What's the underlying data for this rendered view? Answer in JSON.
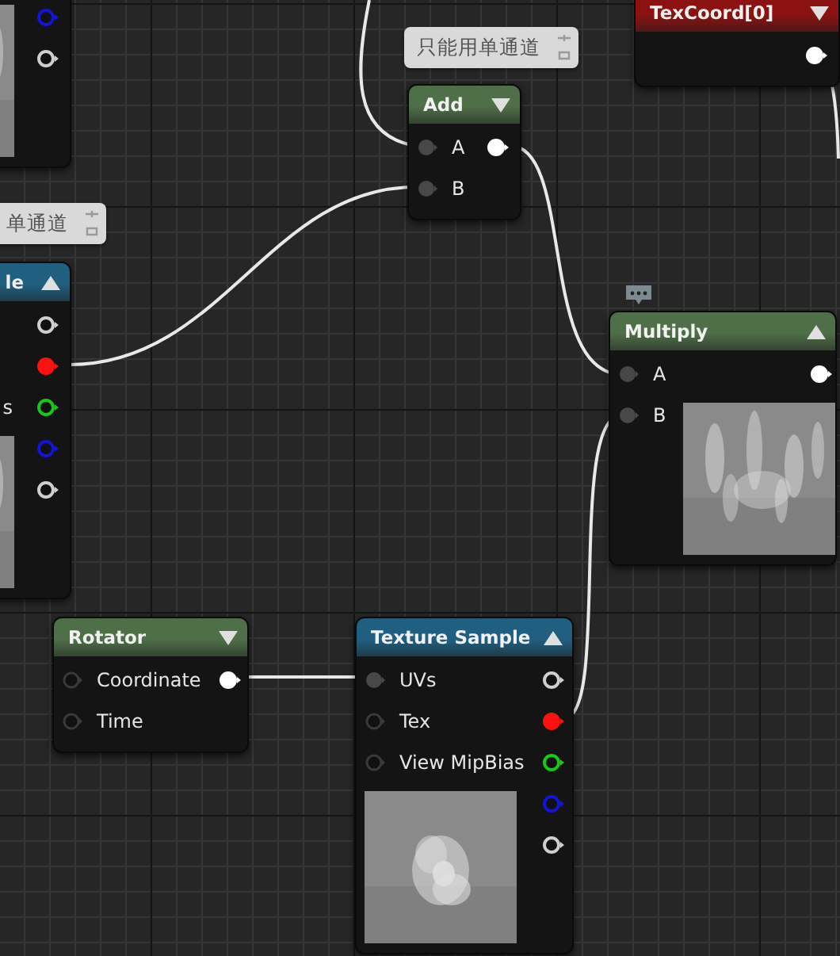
{
  "nodes": [
    {
      "expanded": true,
      "outputs": [
        {
          "color": "#1414d8",
          "connected": false
        },
        {
          "color": "#cfcfcf",
          "connected": false
        }
      ]
    },
    {
      "title": "le",
      "color": "#215f80",
      "expanded": true,
      "comment": "单通道",
      "inputs": [
        {
          "label": "s"
        }
      ],
      "outputs": [
        {
          "color": "#cfcfcf",
          "connected": false
        },
        {
          "color": "#ff1010",
          "connected": true
        },
        {
          "color": "#18c818",
          "connected": false
        },
        {
          "color": "#1414d8",
          "connected": false
        },
        {
          "color": "#cfcfcf",
          "connected": false
        }
      ]
    },
    {
      "title": "Add",
      "color": "#4f6f48",
      "expanded": false,
      "comment": "只能用单通道",
      "inputs": [
        {
          "label": "A",
          "connected": true
        },
        {
          "label": "B",
          "connected": true
        }
      ],
      "outputs": [
        {
          "color": "#ffffff",
          "connected": true
        }
      ]
    },
    {
      "title": "TexCoord[0]",
      "color": "#8c1212",
      "expanded": false,
      "outputs": [
        {
          "color": "#ffffff",
          "connected": true
        }
      ]
    },
    {
      "title": "Multiply",
      "color": "#4f6f48",
      "expanded": true,
      "comment_icon": true,
      "inputs": [
        {
          "label": "A",
          "connected": true
        },
        {
          "label": "B",
          "connected": true
        }
      ],
      "outputs": [
        {
          "color": "#ffffff",
          "connected": true
        }
      ]
    },
    {
      "title": "Rotator",
      "color": "#4f6f48",
      "expanded": false,
      "inputs": [
        {
          "label": "Coordinate",
          "connected": false
        },
        {
          "label": "Time",
          "connected": false
        }
      ],
      "outputs": [
        {
          "color": "#ffffff",
          "connected": true
        }
      ]
    },
    {
      "title": "Texture Sample",
      "color": "#215f80",
      "expanded": true,
      "inputs": [
        {
          "label": "UVs",
          "connected": true
        },
        {
          "label": "Tex",
          "connected": false
        },
        {
          "label": "View MipBias",
          "connected": false
        }
      ],
      "outputs": [
        {
          "color": "#cfcfcf",
          "connected": false
        },
        {
          "color": "#ff1010",
          "connected": true
        },
        {
          "color": "#18c818",
          "connected": false
        },
        {
          "color": "#1414d8",
          "connected": false
        },
        {
          "color": "#cfcfcf",
          "connected": false
        }
      ]
    }
  ]
}
